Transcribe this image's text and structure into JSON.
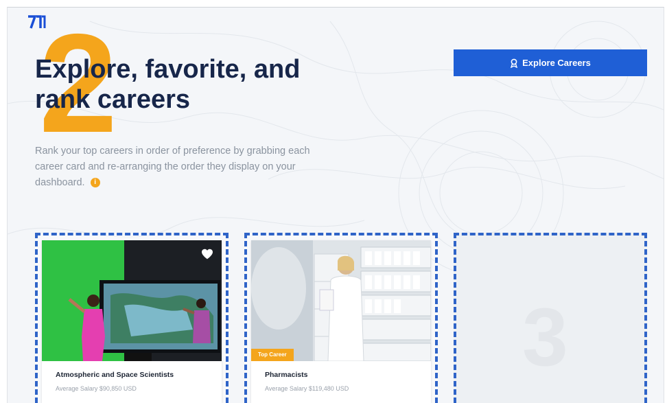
{
  "logo_text": "ᴎ",
  "hero": {
    "step_number": "2",
    "title": "Explore, favorite, and rank careers",
    "description": "Rank your top careers in order of preference by grabbing each career card and re-arranging the order they display on your dashboard.",
    "info_icon": "i"
  },
  "explore_button": {
    "label": "Explore Careers",
    "icon": "award-icon"
  },
  "cards": [
    {
      "title": "Atmospheric and Space Scientists",
      "salary": "Average Salary $90,850 USD",
      "favorited": true,
      "badge": ""
    },
    {
      "title": "Pharmacists",
      "salary": "Average Salary $119,480 USD",
      "favorited": false,
      "badge": "Top Career"
    }
  ],
  "empty_slot": {
    "number": "3"
  },
  "colors": {
    "accent": "#1f5fd6",
    "highlight": "#f4a51c",
    "title": "#17264a",
    "dashed_border": "#2f64c8"
  }
}
